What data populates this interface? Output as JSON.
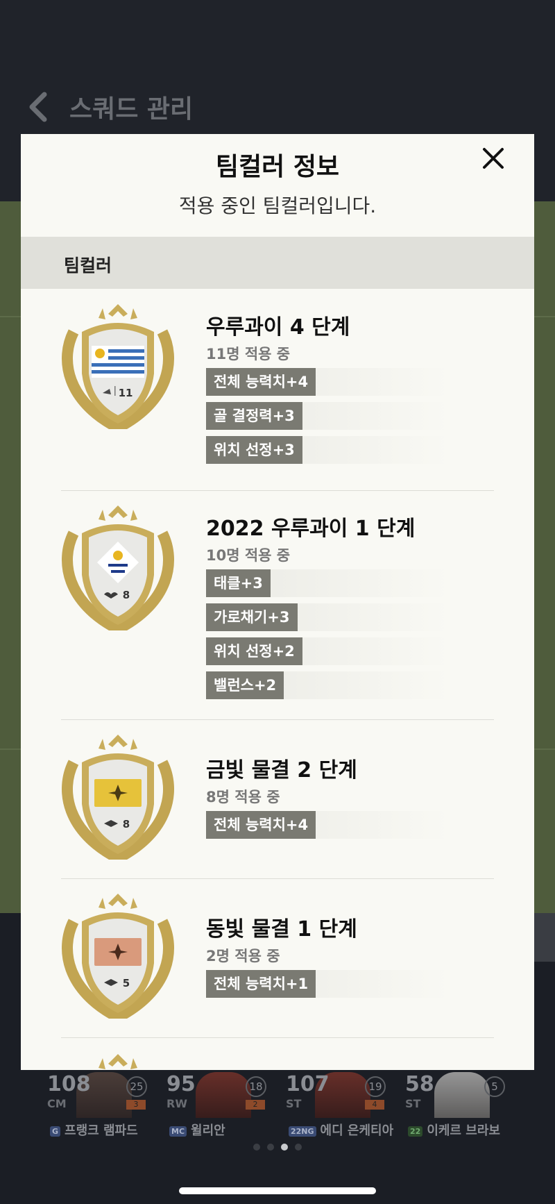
{
  "background": {
    "title": "스쿼드 관리",
    "players": [
      {
        "ovr": "108",
        "pos": "CM",
        "grade": "25",
        "upgrade": "3",
        "badge": "G",
        "name": "프랭크 램파드"
      },
      {
        "ovr": "95",
        "pos": "RW",
        "grade": "18",
        "upgrade": "2",
        "badge": "MC",
        "name": "윌리안"
      },
      {
        "ovr": "107",
        "pos": "ST",
        "grade": "19",
        "upgrade": "4",
        "badge": "22NG",
        "name": "에디 은케티아"
      },
      {
        "ovr": "58",
        "pos": "ST",
        "grade": "5",
        "upgrade": "",
        "badge": "22",
        "name": "이케르 브라보"
      }
    ]
  },
  "modal": {
    "title": "팀컬러 정보",
    "subtitle": "적용 중인 팀컬러입니다.",
    "section_label": "팀컬러",
    "team_colors": [
      {
        "name": "우루과이 4 단계",
        "count": "11명 적용 중",
        "emblem_icon": "uruguay-flag-icon",
        "crest_number": "11",
        "stats": [
          "전체 능력치+4",
          "골 결정력+3",
          "위치 선정+3"
        ]
      },
      {
        "name": "2022 우루과이 1 단계",
        "count": "10명 적용 중",
        "emblem_icon": "uruguay-diamond-icon",
        "crest_number": "8",
        "stats": [
          "태클+3",
          "가로채기+3",
          "위치 선정+2",
          "밸런스+2"
        ]
      },
      {
        "name": "금빛 물결 2 단계",
        "count": "8명 적용 중",
        "emblem_icon": "gold-card-icon",
        "crest_number": "8",
        "stats": [
          "전체 능력치+4"
        ]
      },
      {
        "name": "동빛 물결 1 단계",
        "count": "2명 적용 중",
        "emblem_icon": "bronze-card-icon",
        "crest_number": "5",
        "stats": [
          "전체 능력치+1"
        ]
      }
    ]
  },
  "colors": {
    "modal_bg": "#f9f9f4",
    "tag_bg": "#7a7a72",
    "crest_gold": "#c9ad5b",
    "pitch": "#4f5c3c"
  }
}
